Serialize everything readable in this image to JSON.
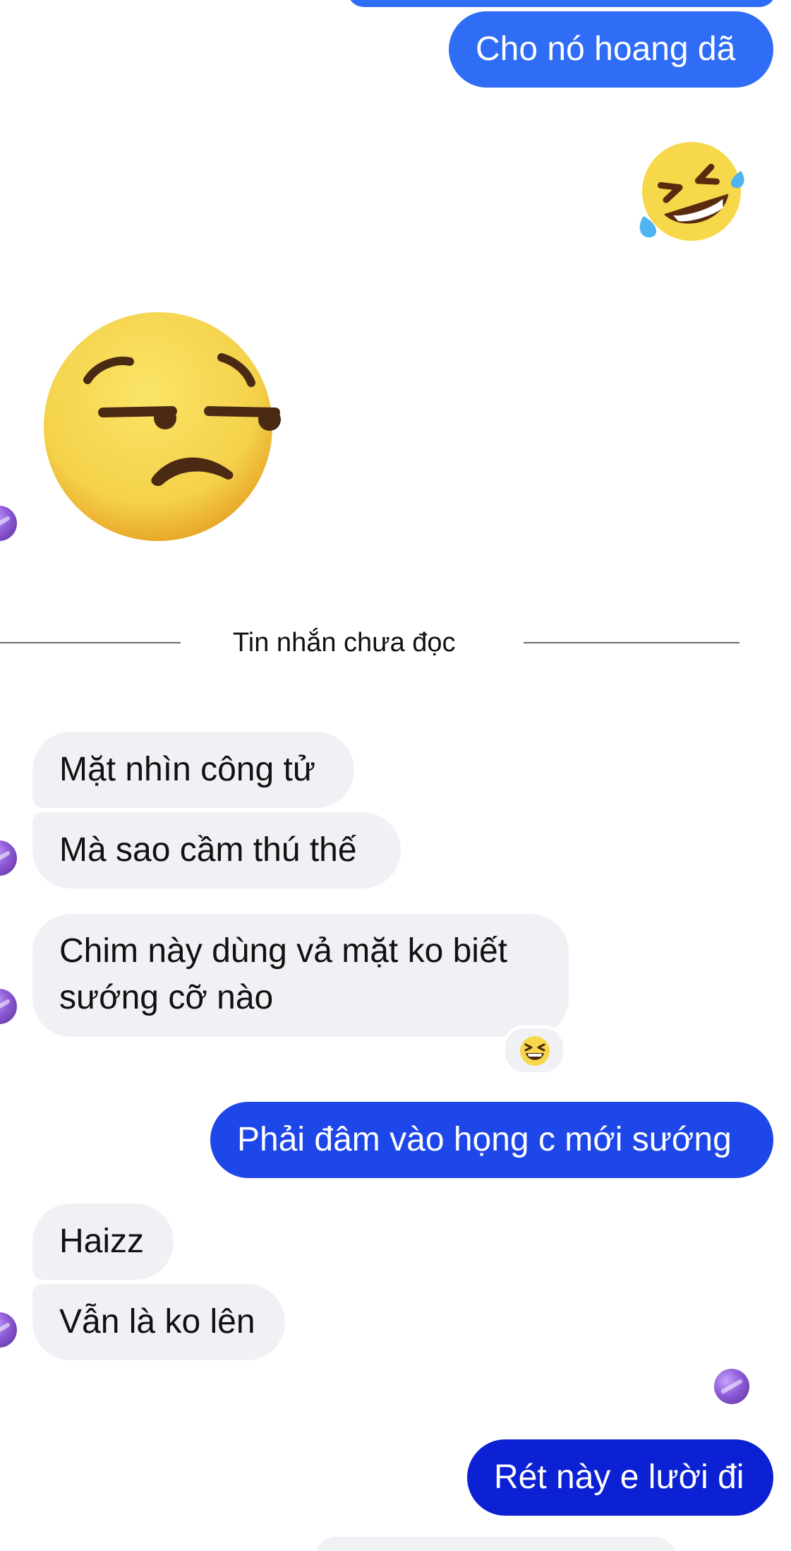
{
  "colors": {
    "outgoing_top": "#2f6df6",
    "outgoing_mid": "#1d47e8",
    "outgoing_bottom": "#0b21d3",
    "incoming_bg": "#f0f1f5",
    "emoji_yellow": "#f7d84a",
    "emoji_orange": "#efb22d",
    "emoji_brown": "#4a2a12"
  },
  "messages": {
    "m1": "Cho nó hoang dã",
    "m2": "Mặt nhìn công tử",
    "m3": "Mà sao cầm thú thế",
    "m4_line1": "Chim này dùng vả mặt ko biết",
    "m4_line2": "sướng cỡ nào",
    "m5": "Phải đâm vào họng c mới sướng",
    "m6": "Haizz",
    "m7": "Vẫn là ko lên",
    "m8": "Rét này e lười đi"
  },
  "divider": {
    "label": "Tin nhắn chưa đọc"
  },
  "icons": {
    "outgoing_emoji": "rolling-on-the-floor-laughing-emoji",
    "incoming_emoji": "unamused-face-emoji",
    "reaction_emoji": "grinning-squinting-face-emoji",
    "avatar": "contact-avatar"
  }
}
